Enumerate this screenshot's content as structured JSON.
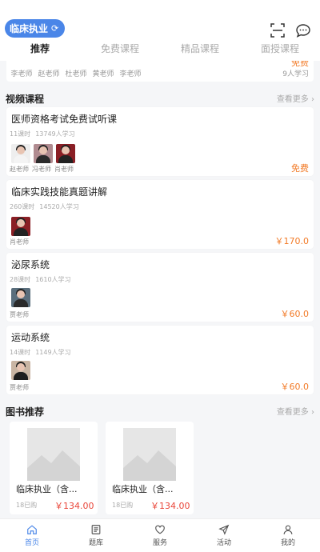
{
  "header": {
    "exam_label": "临床执业",
    "swap_glyph": "⟳",
    "tabs": [
      {
        "label": "推荐",
        "active": true
      },
      {
        "label": "免费课程",
        "active": false
      },
      {
        "label": "精品课程",
        "active": false
      },
      {
        "label": "面授课程",
        "active": false
      }
    ],
    "icons": [
      "scan-icon",
      "chat-icon"
    ]
  },
  "top_partial_card": {
    "teachers": [
      "李老师",
      "赵老师",
      "杜老师",
      "黄老师",
      "李老师"
    ],
    "price": "免费",
    "count": "9人学习"
  },
  "video_section": {
    "title": "视频课程",
    "more": "查看更多"
  },
  "courses": [
    {
      "title": "医师资格考试免费试听课",
      "lessons": "11课时",
      "learners": "13749人学习",
      "teachers": [
        "赵老师",
        "冯老师",
        "肖老师"
      ],
      "price": "免费"
    },
    {
      "title": "临床实践技能真题讲解",
      "lessons": "260课时",
      "learners": "14520人学习",
      "teachers": [
        "肖老师"
      ],
      "price": "￥170.0"
    },
    {
      "title": "泌尿系统",
      "lessons": "28课时",
      "learners": "1610人学习",
      "teachers": [
        "贾老师"
      ],
      "price": "￥60.0"
    },
    {
      "title": "运动系统",
      "lessons": "14课时",
      "learners": "1149人学习",
      "teachers": [
        "贾老师"
      ],
      "price": "￥60.0"
    }
  ],
  "books_section": {
    "title": "图书推荐",
    "more": "查看更多"
  },
  "books": [
    {
      "title": "临床执业（含...",
      "sold": "18已购",
      "price": "￥134.00"
    },
    {
      "title": "临床执业（含...",
      "sold": "18已购",
      "price": "￥134.00"
    }
  ],
  "bottom_nav": [
    {
      "label": "首页",
      "icon": "home-icon",
      "active": true
    },
    {
      "label": "题库",
      "icon": "question-bank-icon",
      "active": false
    },
    {
      "label": "服务",
      "icon": "heart-icon",
      "active": false
    },
    {
      "label": "活动",
      "icon": "send-icon",
      "active": false
    },
    {
      "label": "我的",
      "icon": "user-icon",
      "active": false
    }
  ],
  "colors": {
    "accent": "#4a86e8",
    "price_orange": "#f27b28",
    "price_red": "#e9463a"
  }
}
